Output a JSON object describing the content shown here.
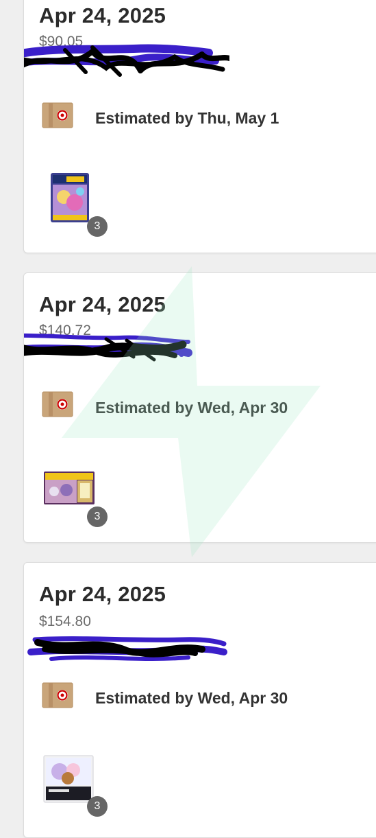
{
  "orders": [
    {
      "date": "Apr 24, 2025",
      "total": "$90.05",
      "delivery": "Estimated by Thu, May 1",
      "item_quantity": "3",
      "product_image": "pokemon-tcg-premium-collection-box",
      "fulfillment_icon": "target-package-icon"
    },
    {
      "date": "Apr 24, 2025",
      "total": "$140.72",
      "delivery": "Estimated by Wed, Apr 30",
      "item_quantity": "3",
      "product_image": "pokemon-tcg-collection-box",
      "fulfillment_icon": "target-package-icon"
    },
    {
      "date": "Apr 24, 2025",
      "total": "$154.80",
      "delivery": "Estimated by Wed, Apr 30",
      "item_quantity": "3",
      "product_image": "pokemon-tcg-elite-trainer-box",
      "fulfillment_icon": "target-package-icon"
    }
  ],
  "colors": {
    "target_red": "#cc0000",
    "cardboard": "#c9a57a",
    "redaction_black": "#000000",
    "redaction_purple": "#3a1fc9",
    "quantity_badge": "#666666",
    "watermark_green": "#9ee8c4"
  }
}
